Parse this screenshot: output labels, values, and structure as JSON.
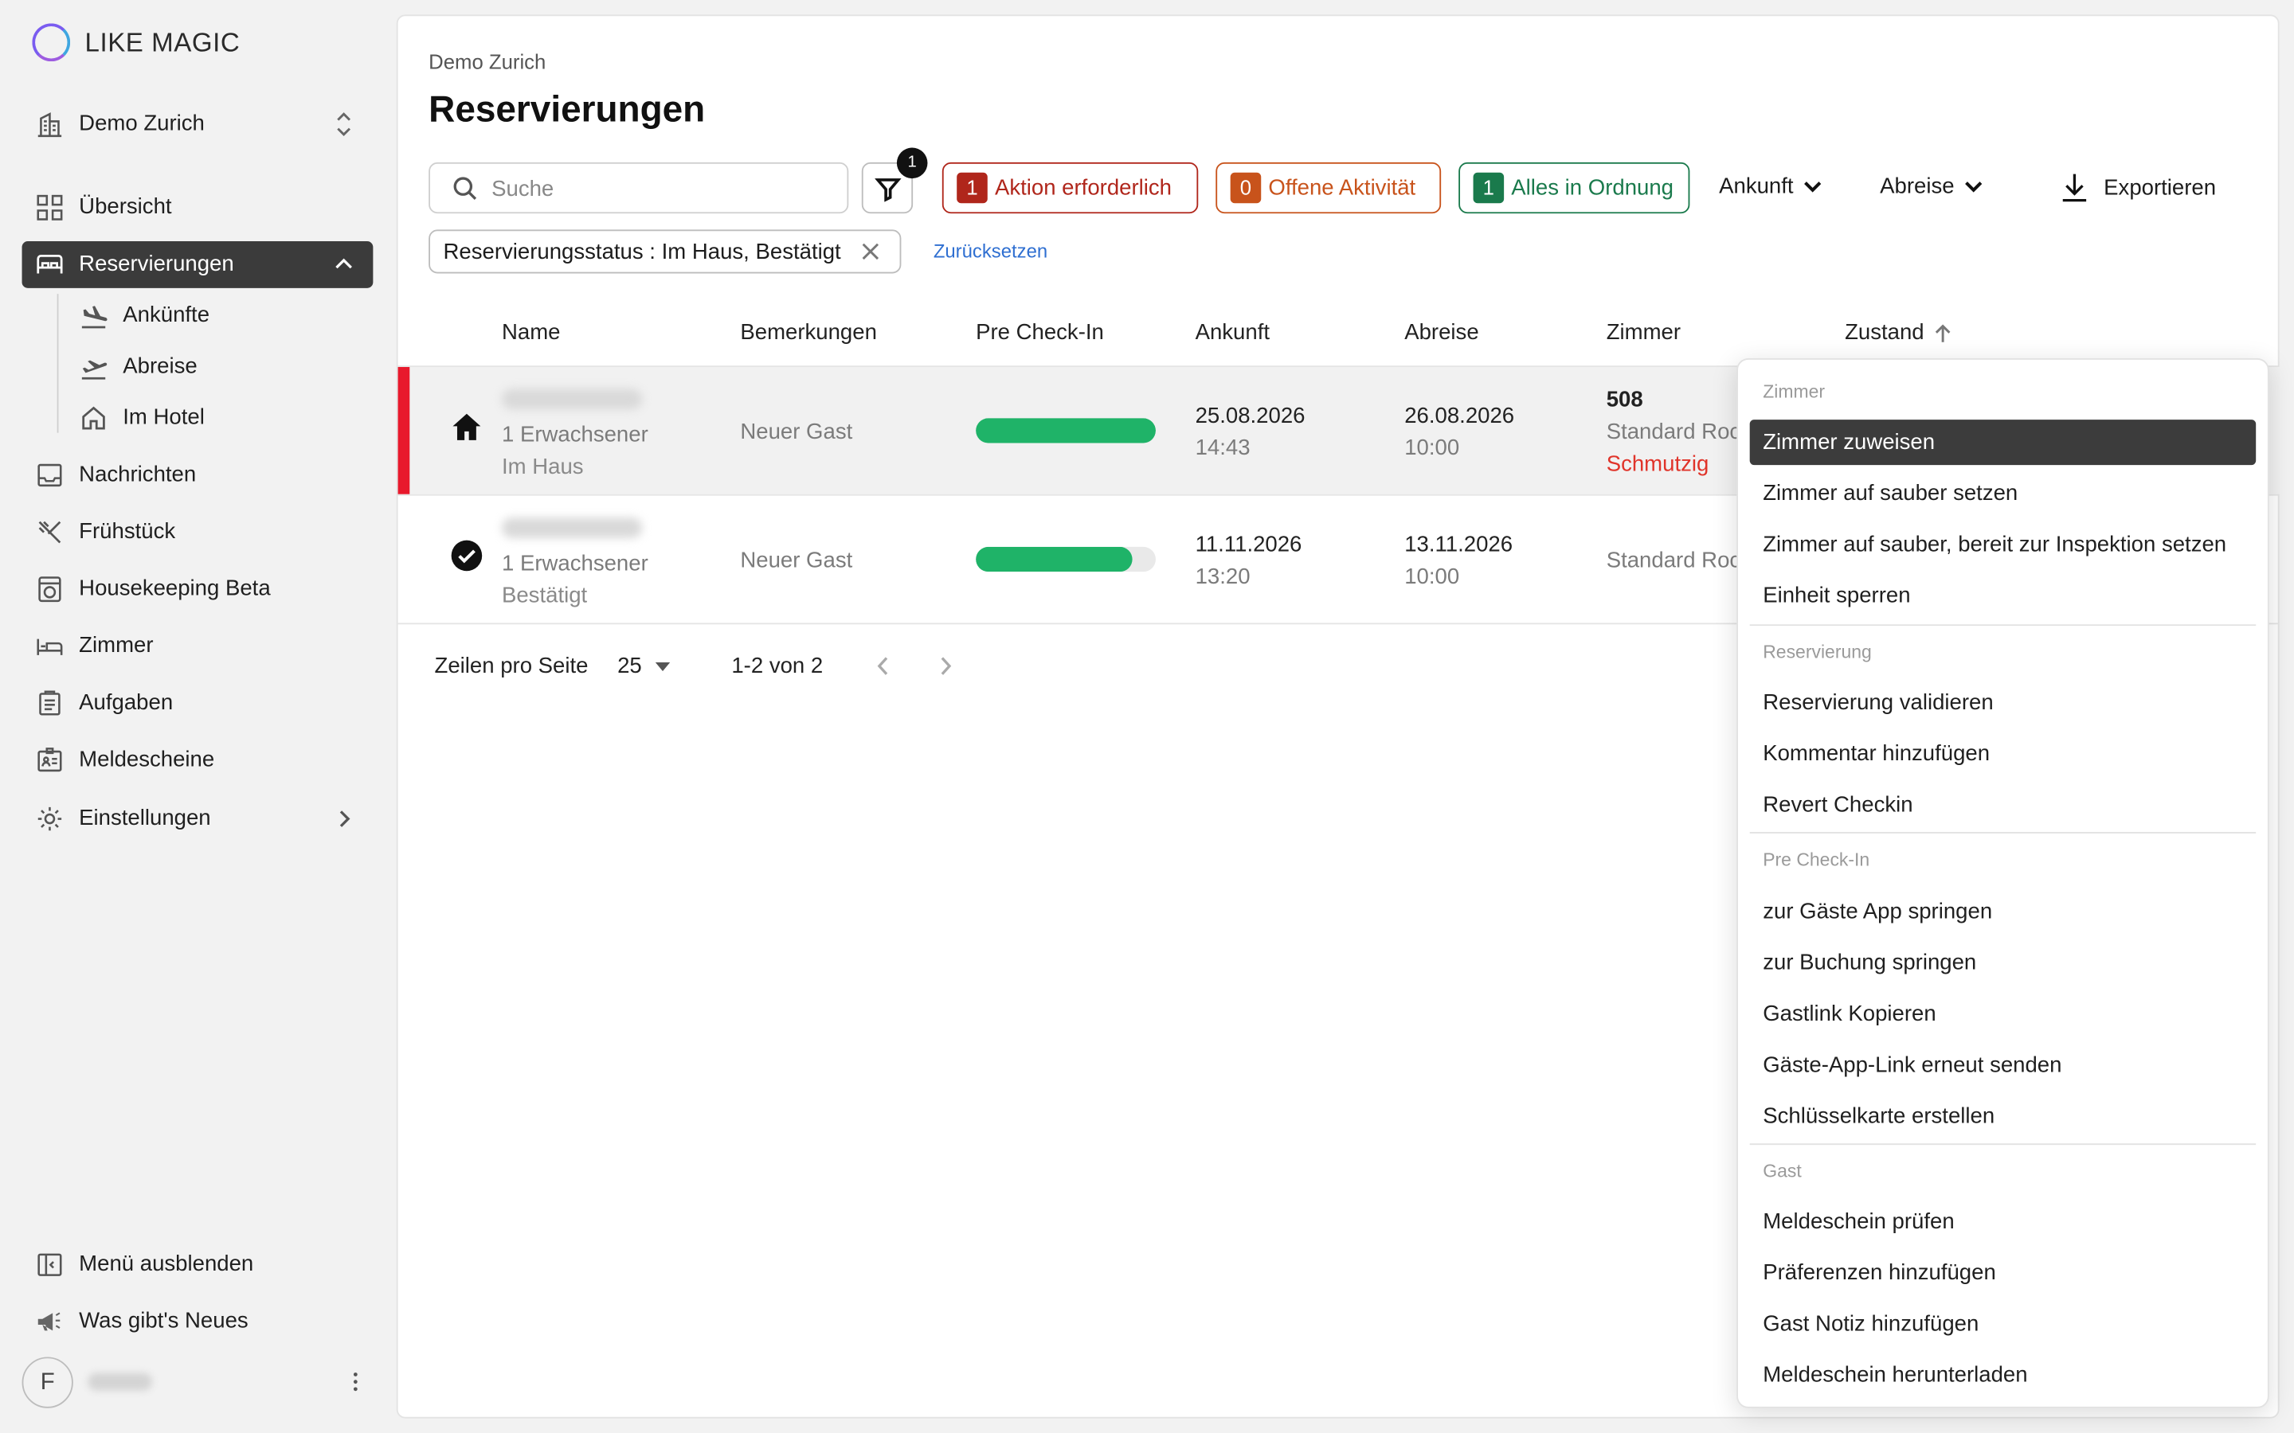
{
  "app": {
    "brand": "LIKE MAGIC",
    "accent_color": "#7a5cf0"
  },
  "sidebar": {
    "property": "Demo Zurich",
    "items": [
      {
        "label": "Übersicht",
        "icon": "grid-icon"
      },
      {
        "label": "Reservierungen",
        "icon": "bed-icon",
        "active": true
      },
      {
        "label": "Ankünfte",
        "icon": "plane-landing-icon"
      },
      {
        "label": "Abreise",
        "icon": "plane-takeoff-icon"
      },
      {
        "label": "Im Hotel",
        "icon": "home-icon"
      },
      {
        "label": "Nachrichten",
        "icon": "inbox-icon"
      },
      {
        "label": "Frühstück",
        "icon": "cutlery-icon"
      },
      {
        "label": "Housekeeping Beta",
        "icon": "washing-machine-icon"
      },
      {
        "label": "Zimmer",
        "icon": "bed-frame-icon"
      },
      {
        "label": "Aufgaben",
        "icon": "clipboard-icon"
      },
      {
        "label": "Meldescheine",
        "icon": "id-card-icon"
      },
      {
        "label": "Einstellungen",
        "icon": "gear-icon"
      }
    ],
    "footer": [
      {
        "label": "Menü ausblenden",
        "icon": "sidebar-collapse-icon"
      },
      {
        "label": "Was gibt's Neues",
        "icon": "megaphone-icon"
      }
    ],
    "user_initial": "F"
  },
  "page": {
    "breadcrumb": "Demo Zurich",
    "title": "Reservierungen",
    "search_placeholder": "Suche",
    "filter_count": "1",
    "status_pills": [
      {
        "count": "1",
        "label": "Aktion erforderlich",
        "color": "#b0261b"
      },
      {
        "count": "0",
        "label": "Offene Aktivität",
        "color": "#c8531b"
      },
      {
        "count": "1",
        "label": "Alles in Ordnung",
        "color": "#1a7a4c"
      }
    ],
    "dropdowns": {
      "arrival": "Ankunft",
      "departure": "Abreise"
    },
    "export_label": "Exportieren",
    "active_filter": "Reservierungsstatus : Im Haus, Bestätigt",
    "reset_label": "Zurücksetzen"
  },
  "table": {
    "headers": {
      "name": "Name",
      "notes": "Bemerkungen",
      "precheckin": "Pre Check-In",
      "arrival": "Ankunft",
      "departure": "Abreise",
      "room": "Zimmer",
      "status": "Zustand"
    },
    "rows": [
      {
        "status_icon": "house-icon",
        "guests": "1 Erwachsener",
        "state": "Im Haus",
        "notes": "Neuer Gast",
        "precheckin_progress": 1.0,
        "arrival_date": "25.08.2026",
        "arrival_time": "14:43",
        "departure_date": "26.08.2026",
        "departure_time": "10:00",
        "room_number": "508",
        "room_type": "Standard Roc",
        "room_state": "Schmutzig",
        "action_required": true
      },
      {
        "status_icon": "check-circle-icon",
        "guests": "1 Erwachsener",
        "state": "Bestätigt",
        "notes": "Neuer Gast",
        "precheckin_progress": 0.87,
        "arrival_date": "11.11.2026",
        "arrival_time": "13:20",
        "departure_date": "13.11.2026",
        "departure_time": "10:00",
        "room_type": "Standard Roc"
      }
    ]
  },
  "pagination": {
    "rows_per_page_label": "Zeilen pro Seite",
    "rows_per_page": "25",
    "range": "1-2 von 2"
  },
  "context_menu": {
    "sections": [
      {
        "title": "Zimmer",
        "items": [
          "Zimmer zuweisen",
          "Zimmer auf sauber setzen",
          "Zimmer auf sauber, bereit zur Inspektion setzen",
          "Einheit sperren"
        ]
      },
      {
        "title": "Reservierung",
        "items": [
          "Reservierung validieren",
          "Kommentar hinzufügen",
          "Revert Checkin"
        ]
      },
      {
        "title": "Pre Check-In",
        "items": [
          "zur Gäste App springen",
          "zur Buchung springen",
          "Gastlink Kopieren",
          "Gäste-App-Link erneut senden",
          "Schlüsselkarte erstellen"
        ]
      },
      {
        "title": "Gast",
        "items": [
          "Meldeschein prüfen",
          "Präferenzen hinzufügen",
          "Gast Notiz hinzufügen",
          "Meldeschein herunterladen"
        ]
      }
    ],
    "highlighted": "Zimmer zuweisen"
  }
}
